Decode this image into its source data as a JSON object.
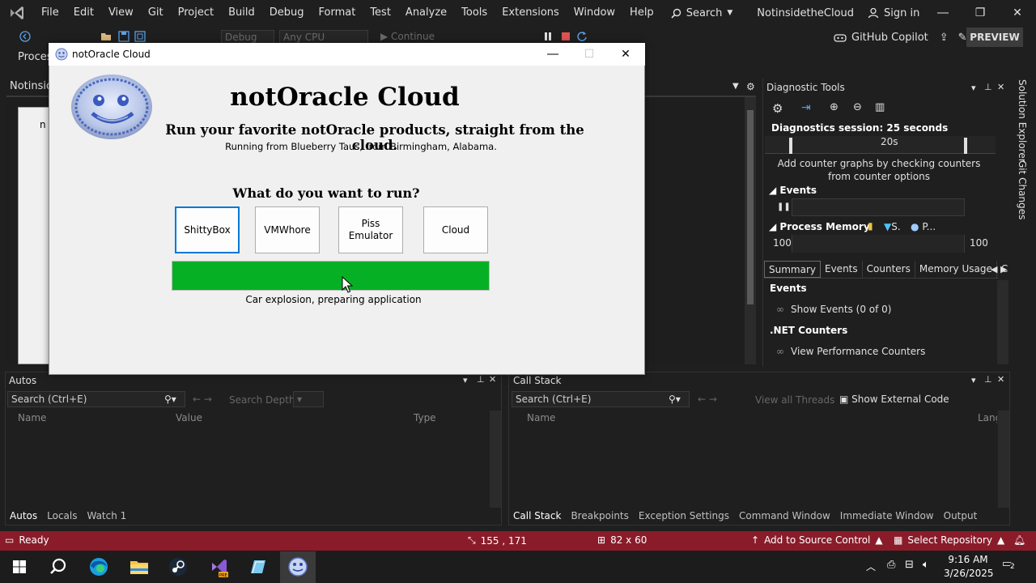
{
  "vs": {
    "menus": [
      "File",
      "Edit",
      "View",
      "Git",
      "Project",
      "Build",
      "Debug",
      "Format",
      "Test",
      "Analyze",
      "Tools",
      "Extensions",
      "Window",
      "Help"
    ],
    "search_label": "Search",
    "solution_name": "NotinsidetheCloud",
    "signin": "Sign in",
    "toolbar": {
      "config": "Debug",
      "platform": "Any CPU",
      "continue": "Continue",
      "copilot": "GitHub Copilot",
      "preview": "PREVIEW",
      "process_label": "Proces"
    },
    "doc_tab": "Notinside",
    "doc_tab_inner": "n"
  },
  "diagnostics": {
    "title": "Diagnostic Tools",
    "session": "Diagnostics session: 25 seconds",
    "timeline_label": "20s",
    "hint": "Add counter graphs by checking counters from counter options",
    "events_label": "Events",
    "process_memory_label": "Process Memory",
    "legend_s": "S.",
    "legend_p": "P...",
    "mem_left": "100",
    "mem_right": "100",
    "tabs": [
      "Summary",
      "Events",
      "Counters",
      "Memory Usage",
      "C"
    ],
    "rows": [
      {
        "type": "head",
        "text": "Events"
      },
      {
        "type": "item",
        "text": "Show Events (0 of 0)"
      },
      {
        "type": "head",
        "text": ".NET Counters"
      },
      {
        "type": "item",
        "text": "View Performance Counters"
      }
    ],
    "side_tabs": [
      "Solution Explorer",
      "Git Changes"
    ]
  },
  "autos": {
    "title": "Autos",
    "search_placeholder": "Search (Ctrl+E)",
    "search_depth": "Search Depth:",
    "columns": [
      "Name",
      "Value",
      "Type"
    ],
    "tabs": [
      "Autos",
      "Locals",
      "Watch 1"
    ]
  },
  "callstack": {
    "title": "Call Stack",
    "search_placeholder": "Search (Ctrl+E)",
    "view_threads": "View all Threads",
    "show_external": "Show External Code",
    "columns": [
      "Name",
      "Lang"
    ],
    "tabs": [
      "Call Stack",
      "Breakpoints",
      "Exception Settings",
      "Command Window",
      "Immediate Window",
      "Output"
    ]
  },
  "status": {
    "ready": "Ready",
    "position": "155 , 171",
    "size": "82 x 60",
    "source_control": "Add to Source Control",
    "repo": "Select Repository"
  },
  "taskbar": {
    "time": "9:16 AM",
    "date": "3/26/2025",
    "notifications": "2"
  },
  "app": {
    "window_title": "notOracle Cloud",
    "heading": "notOracle Cloud",
    "tagline": "Run your favorite notOracle products, straight from the cloud.",
    "location": "Running from Blueberry Taus, from Birmingham, Alabama.",
    "question": "What do you want to run?",
    "buttons": [
      "ShittyBox",
      "VMWhore",
      "Piss Emulator",
      "Cloud"
    ],
    "progress_percent": 100,
    "progress_color": "#06b025",
    "status_text": "Car explosion, preparing application"
  },
  "colors": {
    "statusbar": "#8a1c2a",
    "accent": "#0078d7"
  }
}
